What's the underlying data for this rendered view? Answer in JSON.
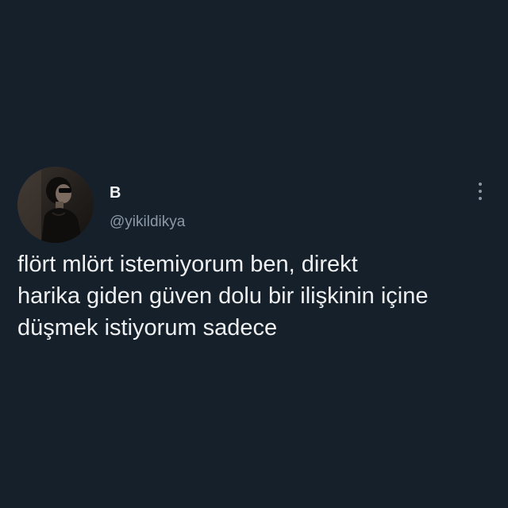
{
  "tweet": {
    "author": {
      "display_name": "B",
      "handle": "@yikildikya",
      "avatar_icon": "profile-photo-avatar"
    },
    "menu_icon": "more-vertical-icon",
    "text_lines": [
      "flört mlört istemiyorum ben, direkt",
      "harika giden güven dolu bir ilişkinin içine",
      "düşmek istiyorum sadece"
    ]
  },
  "colors": {
    "background": "#16202b",
    "primary_text": "#eef0f1",
    "secondary_text": "#8b98a5"
  }
}
